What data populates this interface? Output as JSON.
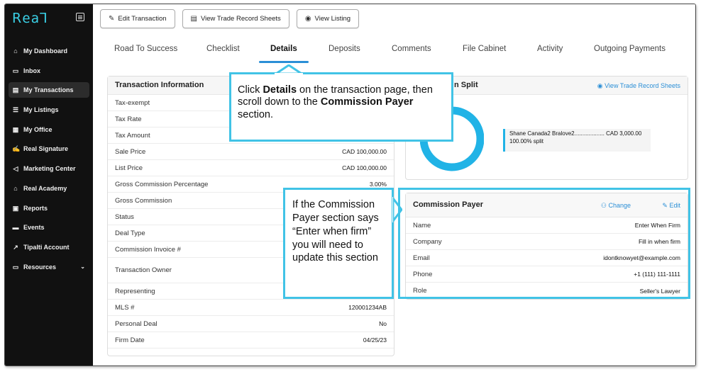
{
  "app": {
    "logo_text": "ꓣeaꓶ"
  },
  "sidebar": {
    "items": [
      {
        "label": "My Dashboard",
        "icon": "home-icon",
        "glyph": "⌂"
      },
      {
        "label": "Inbox",
        "icon": "inbox-icon",
        "glyph": "▭"
      },
      {
        "label": "My Transactions",
        "icon": "transactions-icon",
        "glyph": "▤",
        "active": true
      },
      {
        "label": "My Listings",
        "icon": "listings-icon",
        "glyph": "☰"
      },
      {
        "label": "My Office",
        "icon": "office-icon",
        "glyph": "▦"
      },
      {
        "label": "Real Signature",
        "icon": "signature-icon",
        "glyph": "✍"
      },
      {
        "label": "Marketing Center",
        "icon": "megaphone-icon",
        "glyph": "◁"
      },
      {
        "label": "Real Academy",
        "icon": "academy-icon",
        "glyph": "⌂"
      },
      {
        "label": "Reports",
        "icon": "reports-icon",
        "glyph": "▣"
      },
      {
        "label": "Events",
        "icon": "calendar-icon",
        "glyph": "▬"
      },
      {
        "label": "Tipalti Account",
        "icon": "external-link-icon",
        "glyph": "↗"
      },
      {
        "label": "Resources",
        "icon": "resources-icon",
        "glyph": "▭",
        "caret": "⌄"
      }
    ]
  },
  "toolbar": {
    "edit_transaction": "Edit Transaction",
    "view_trade_record_sheets": "View Trade Record Sheets",
    "view_listing": "View Listing"
  },
  "tabs": [
    "Road To Success",
    "Checklist",
    "Details",
    "Deposits",
    "Comments",
    "File Cabinet",
    "Activity",
    "Outgoing Payments"
  ],
  "transaction_info": {
    "title": "Transaction Information",
    "rows": [
      {
        "label": "Tax-exempt",
        "value": ""
      },
      {
        "label": "Tax Rate",
        "value": ""
      },
      {
        "label": "Tax Amount",
        "value": ""
      },
      {
        "label": "Sale Price",
        "value": "CAD 100,000.00"
      },
      {
        "label": "List Price",
        "value": "CAD 100,000.00"
      },
      {
        "label": "Gross Commission Percentage",
        "value": "3.00%"
      },
      {
        "label": "Gross Commission",
        "value": ""
      },
      {
        "label": "Status",
        "value": ""
      },
      {
        "label": "Deal Type",
        "value": ""
      },
      {
        "label": "Commission Invoice #",
        "value": ""
      },
      {
        "label": "Transaction Owner",
        "value": ""
      },
      {
        "label": "Representing",
        "value": ""
      },
      {
        "label": "MLS #",
        "value": "120001234AB"
      },
      {
        "label": "Personal Deal",
        "value": "No"
      },
      {
        "label": "Firm Date",
        "value": "04/25/23"
      }
    ]
  },
  "commission_split": {
    "title_fragment": "n Split",
    "view_link": "View Trade Record Sheets",
    "agent_line": "Shane Canada2 Bralove2................... CAD 3,000.00",
    "split_pct": "100.00% split",
    "split_fraction": 1.0,
    "ring_color": "#21b3e6"
  },
  "commission_payer": {
    "title": "Commission Payer",
    "change_label": "Change",
    "edit_label": "Edit",
    "rows": [
      {
        "label": "Name",
        "value": "Enter When Firm"
      },
      {
        "label": "Company",
        "value": "Fill in when firm"
      },
      {
        "label": "Email",
        "value": "idontknowyet@example.com"
      },
      {
        "label": "Phone",
        "value": "+1 (111) 111-1111"
      },
      {
        "label": "Role",
        "value": "Seller's Lawyer"
      }
    ]
  },
  "callouts": {
    "c1_part1": "Click ",
    "c1_bold1": "Details",
    "c1_part2": " on the transaction page, then scroll down to the ",
    "c1_bold2": "Commission Payer",
    "c1_part3": " section.",
    "c2_text": "If the Commission Payer section says “Enter when firm” you will need to update this section"
  },
  "colors": {
    "accent": "#2b8fd6",
    "callout_border": "#41c3e6",
    "sidebar_bg": "#111111"
  }
}
